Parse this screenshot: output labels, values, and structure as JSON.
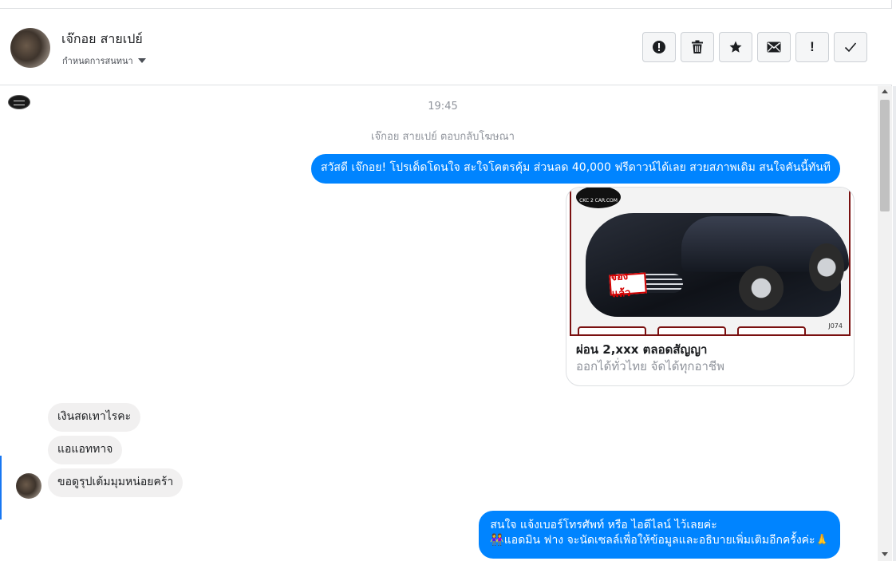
{
  "header": {
    "contact_name": "เจ๊กอย สายเปย์",
    "assign_label": "กำหนดการสนทนา",
    "toolbar": [
      {
        "name": "report-spam-button",
        "icon": "alert-circle-icon"
      },
      {
        "name": "delete-button",
        "icon": "trash-icon"
      },
      {
        "name": "star-button",
        "icon": "star-icon"
      },
      {
        "name": "mark-unread-button",
        "icon": "envelope-icon"
      },
      {
        "name": "follow-up-button",
        "icon": "exclamation-icon",
        "glyph": "!"
      },
      {
        "name": "mark-done-button",
        "icon": "checkmark-icon"
      }
    ]
  },
  "chat": {
    "timestamp": "19:45",
    "reply_context": "เจ๊กอย สายเปย์ ตอบกลับโฆษณา",
    "outgoing_1": "สวัสดี เจ๊กอย! โปรเด็ดโดนใจ สะใจโคตรคุ้ม ส่วนลด 40,000 ฟรีดาวน์ได้เลย สวยสภาพเดิม สนใจคันนี้ทันที",
    "ad_card": {
      "logo_text": "CKC 2 CAR.COM",
      "stamp_text": "จองแล้ว",
      "code": "J074",
      "title": "ผ่อน 2,xxx ตลอดสัญญา",
      "subtitle": "ออกได้ทั่วไทย จัดได้ทุกอาชีพ"
    },
    "incoming": [
      "เงินสดเทาไรคะ",
      "แอแอททาจ",
      "ขอดูรุปเต้มมุมหน่อยคร้า"
    ],
    "outgoing_2_line1": "สนใจ แจ้งเบอร์โทรศัพท์ หรือ ไอดีไลน์  ไว้เลยค่ะ",
    "outgoing_2_line2": "👭แอดมิน ฟาง จะนัดเซลล์เพื่อให้ข้อมูลและอธิบายเพิ่มเติมอีกครั้งค่ะ🙏"
  },
  "colors": {
    "outgoing_bubble": "#0084ff",
    "incoming_bubble": "#f1f0f0",
    "meta_text": "#90949c"
  }
}
